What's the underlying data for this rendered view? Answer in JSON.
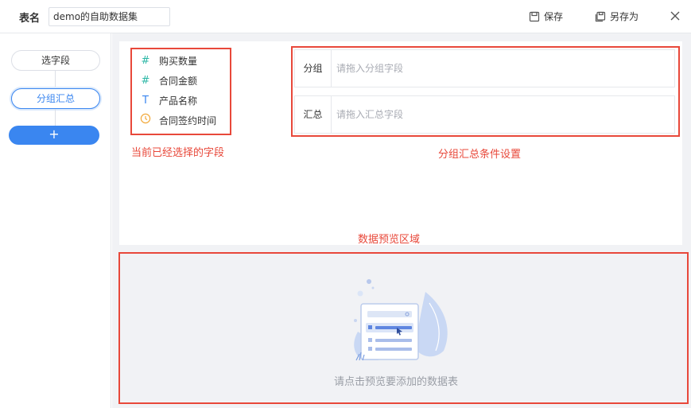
{
  "header": {
    "table_name_label": "表名",
    "table_name_value": "demo的自助数据集",
    "save_label": "保存",
    "save_as_label": "另存为"
  },
  "sidebar": {
    "steps": [
      {
        "label": "选字段"
      },
      {
        "label": "分组汇总"
      }
    ],
    "add_label": "+"
  },
  "fields": [
    {
      "icon": "number-hash-icon",
      "label": "购买数量"
    },
    {
      "icon": "number-hash-icon",
      "label": "合同金额"
    },
    {
      "icon": "text-t-icon",
      "label": "产品名称"
    },
    {
      "icon": "clock-icon",
      "label": "合同签约时间"
    }
  ],
  "group_rows": [
    {
      "label": "分组",
      "placeholder": "请拖入分组字段"
    },
    {
      "label": "汇总",
      "placeholder": "请拖入汇总字段"
    }
  ],
  "annotations": {
    "selected_fields": "当前已经选择的字段",
    "group_settings": "分组汇总条件设置",
    "preview_area": "数据预览区域"
  },
  "preview": {
    "empty_text": "请点击预览要添加的数据表"
  },
  "colors": {
    "accent": "#3a86f0",
    "annotation_red": "#e8483a",
    "number_icon": "#2cb7a6",
    "time_icon": "#f2a93b"
  }
}
